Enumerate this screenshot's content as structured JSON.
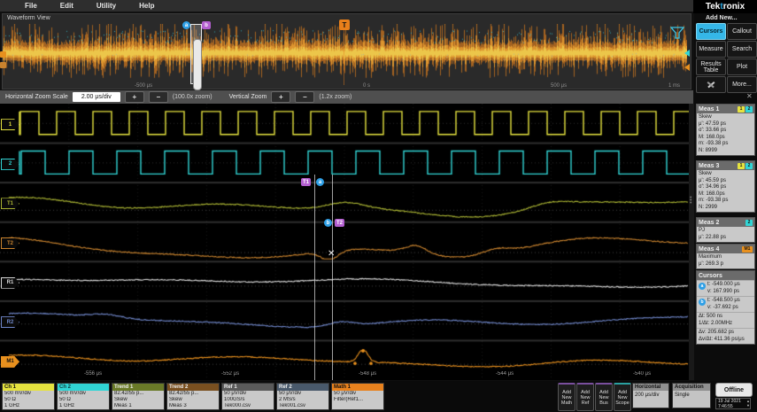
{
  "menu": {
    "items": [
      "File",
      "Edit",
      "Utility",
      "Help"
    ]
  },
  "overview": {
    "title": "Waveform View",
    "axis_labels": [
      "-500 μs",
      "0 s",
      "500 μs",
      "1 ms"
    ],
    "cursor_a": "a",
    "cursor_b": "b",
    "trigger_label": "T"
  },
  "zoombar": {
    "h_label": "Horizontal Zoom Scale",
    "h_scale": "2.00 μs/div",
    "plus": "+",
    "minus": "−",
    "h_zoom": "(100.0x zoom)",
    "v_label": "Vertical Zoom",
    "v_zoom": "(1.2x zoom)",
    "close": "✕"
  },
  "main": {
    "slices": [
      {
        "badge": "1",
        "scale_top": "600 mV",
        "scale_bottom": "-600 mV"
      },
      {
        "badge": "2",
        "scale_top": "600 mV",
        "scale_bottom": "-600 mV"
      },
      {
        "badge": "T1",
        "scale_top": "168 ps",
        "scale_bottom": "-93 ps"
      },
      {
        "badge": "T2",
        "scale_top": "168 ps",
        "scale_bottom": "-93 ps"
      },
      {
        "badge": "R1",
        "scale_top": "250 μV",
        "scale_bottom": "-250 μV"
      },
      {
        "badge": "R2",
        "scale_top": "250 μV",
        "scale_bottom": "-250 μV"
      },
      {
        "badge": "M1",
        "scale_top": "250 μV",
        "scale_bottom": "-250 μV"
      }
    ],
    "axis_labels": [
      "-556 μs",
      "-552 μs",
      "-548 μs",
      "-544 μs",
      "-540 μs"
    ],
    "cursor_a": "a",
    "cursor_b": "b",
    "source_a": "T1",
    "source_b": "T2",
    "x_marker": "✕"
  },
  "sidebar": {
    "brand": "Tektronix",
    "add_new": "Add New...",
    "buttons": [
      "Cursors",
      "Callout",
      "Measure",
      "Search",
      "Results Table",
      "Plot",
      "More..."
    ],
    "meas1": {
      "name": "Meas 1",
      "badge1": "1",
      "badge2": "2",
      "lines": [
        "Skew",
        "μ': 47.59 ps",
        "σ': 33.66 ps",
        "M: 168.0ps",
        "m: -93.38 ps",
        "N: 8999"
      ]
    },
    "meas3": {
      "name": "Meas 3",
      "badge1": "1",
      "badge2": "2",
      "lines": [
        "Skew",
        "μ': 45.59 ps",
        "σ': 34.96 ps",
        "M: 168.0ps",
        "m: -93.38 ps",
        "N: 2999"
      ]
    },
    "meas2": {
      "name": "Meas 2",
      "badge1": "2",
      "lines": [
        "PJ",
        "μ': 22.88 ps"
      ]
    },
    "meas4": {
      "name": "Meas 4",
      "badge1": "M1",
      "lines": [
        "Maximum",
        "μ': 269.3 p"
      ]
    },
    "cursors_panel": {
      "title": "Cursors",
      "a_label": "a",
      "a_line1": "t: -549.000 μs",
      "a_line2": "v: 167.990 ps",
      "b_label": "b",
      "b_line1": "t: -548.500 μs",
      "b_line2": "v: -37.692 ps",
      "d_line1": "Δt: 500 ns",
      "d_line2": "1/Δt: 2.00MHz",
      "d_line3": "Δv: 205.682 ps",
      "d_line4": "Δv/Δt: 411.36 ps/μs"
    }
  },
  "bottombar": {
    "channels": [
      {
        "name": "Ch 1",
        "lines": [
          "500 mV/div",
          "50 Ω",
          "1 GHz"
        ]
      },
      {
        "name": "Ch 2",
        "lines": [
          "500 mV/div",
          "50 Ω",
          "1 GHz"
        ]
      },
      {
        "name": "Trend 1",
        "lines": [
          "82.42/55 p...",
          "Skew",
          "Meas 1"
        ]
      },
      {
        "name": "Trend 2",
        "lines": [
          "82.42/55 p...",
          "Skew",
          "Meas 3"
        ]
      },
      {
        "name": "Ref 1",
        "lines": [
          "50 μV/div",
          "100GS/s",
          "Tek000.csv"
        ]
      },
      {
        "name": "Ref 2",
        "lines": [
          "50 μV/div",
          "2 MS/s",
          "Tek001.csv"
        ]
      },
      {
        "name": "Math 1",
        "lines": [
          "50 μV/div",
          "Filter(Ref1...",
          ""
        ]
      }
    ],
    "add_buttons": [
      "Add New Math",
      "Add New Ref",
      "Add New Bus",
      "Add New Scope"
    ],
    "horizontal": {
      "title": "Horizontal",
      "value": "200 μs/div"
    },
    "acquisition": {
      "title": "Acquisition",
      "value": "Single"
    },
    "offline": "Offline",
    "date": "19 Jul 2021",
    "time": "7:46:55"
  },
  "colors": {
    "accent": "#35b7e8",
    "ch1": "#e6e33f",
    "ch2": "#31d5d5",
    "t1": "#aab433",
    "t2": "#c9832e",
    "r1": "#d8d8d8",
    "r2": "#6f86c9",
    "m1": "#e8901e",
    "trend1_head": "#6a7a28",
    "trend2_head": "#7a5020",
    "ref1_head": "#5a5a5a",
    "ref2_head": "#49596b",
    "math1_head": "#e8821e",
    "cursor_a": "#2e9fe6",
    "cursor_b": "#b45fd0",
    "trigger": "#e87f1a"
  }
}
